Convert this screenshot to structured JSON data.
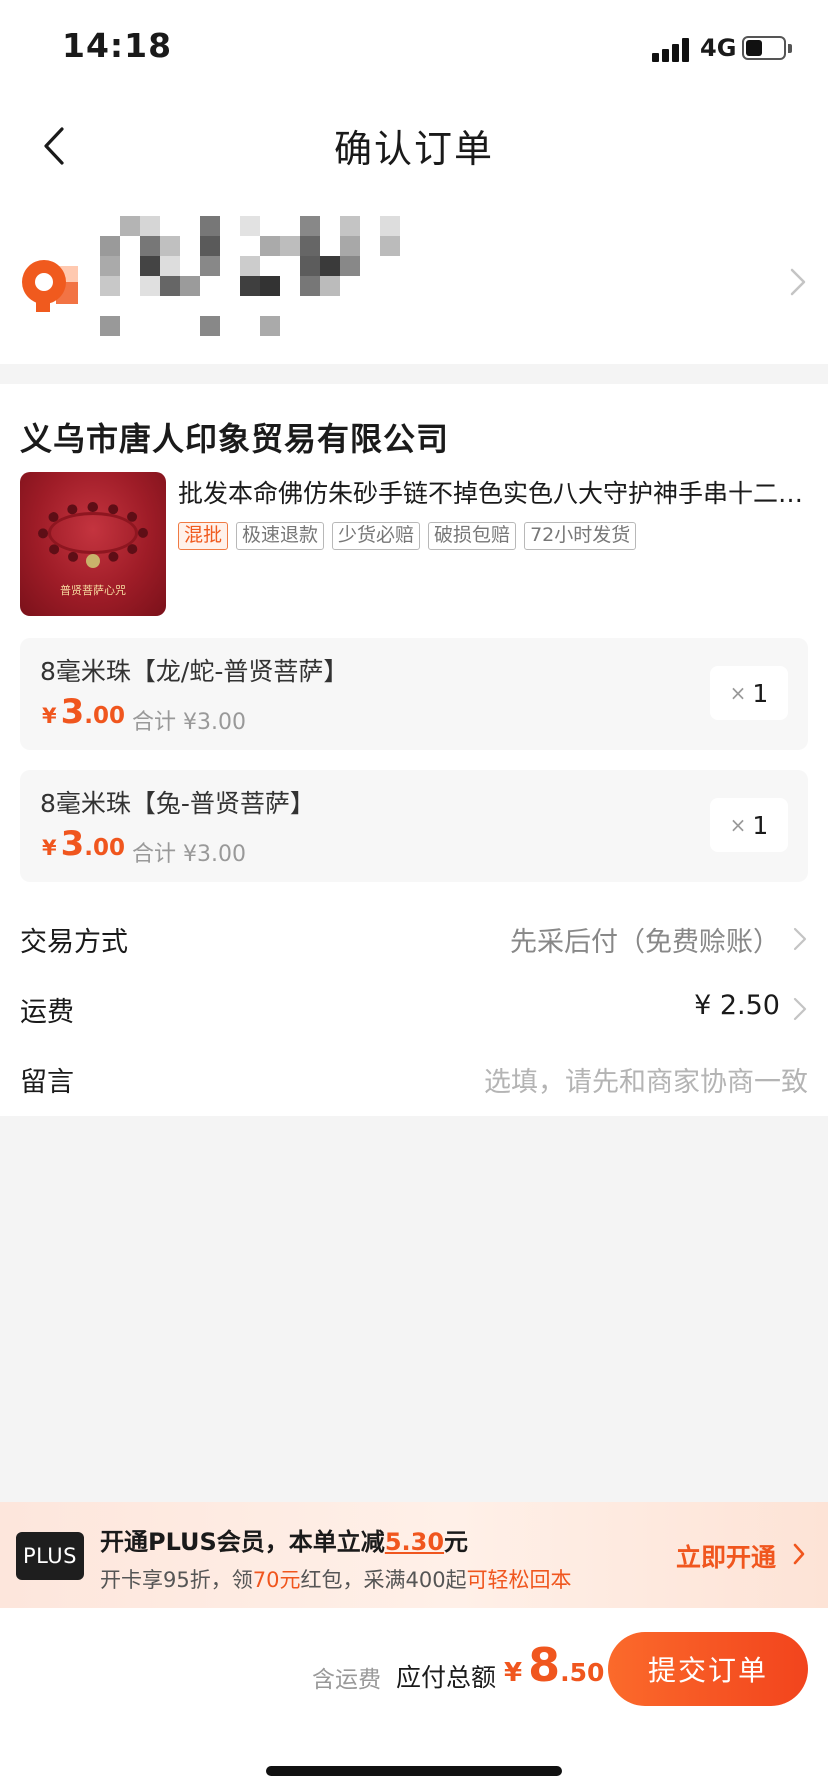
{
  "status_bar": {
    "time": "14:18",
    "network": "4G"
  },
  "nav": {
    "title": "确认订单"
  },
  "order": {
    "store_name": "义乌市唐人印象贸易有限公司",
    "product": {
      "title": "批发本命佛仿朱砂手链不掉色实色八大守护神手串十二生肖饰品",
      "image_caption": "普贤菩萨心咒",
      "tags": [
        "混批",
        "极速退款",
        "少货必赔",
        "破损包赔",
        "72小时发货"
      ]
    },
    "skus": [
      {
        "name": "8毫米珠【龙/蛇-普贤菩萨】",
        "currency": "¥",
        "price_int": "3",
        "price_dec": ".00",
        "subtotal": "合计 ¥3.00",
        "qty_x": "×",
        "qty": "1"
      },
      {
        "name": "8毫米珠【兔-普贤菩萨】",
        "currency": "¥",
        "price_int": "3",
        "price_dec": ".00",
        "subtotal": "合计 ¥3.00",
        "qty_x": "×",
        "qty": "1"
      }
    ],
    "rows": {
      "trade": {
        "label": "交易方式",
        "value": "先采后付（免费赊账）"
      },
      "shipping": {
        "label": "运费",
        "value": "¥ 2.50"
      },
      "message": {
        "label": "留言",
        "placeholder": "选填，请先和商家协商一致"
      }
    }
  },
  "plus": {
    "logo": "PLUS",
    "title_prefix": "开通PLUS会员，本单立减",
    "discount": "5.30",
    "title_suffix": "元",
    "sub_1": "开卡享95折，领",
    "sub_red_amount": "70元",
    "sub_2": "红包，采满400起",
    "sub_red_tail": "可轻松回本",
    "cta": "立即开通"
  },
  "bottom": {
    "freight_note": "含运费",
    "total_label": "应付总额",
    "currency": "¥",
    "total_int": "8",
    "total_dec": ".50",
    "submit": "提交订单"
  },
  "colors": {
    "accent": "#f0561e",
    "button_start": "#fb6a2b",
    "button_end": "#f2441d"
  },
  "icons": [
    "back-arrow-icon",
    "location-pin-icon",
    "chevron-right-icon",
    "signal-icon",
    "battery-icon"
  ]
}
